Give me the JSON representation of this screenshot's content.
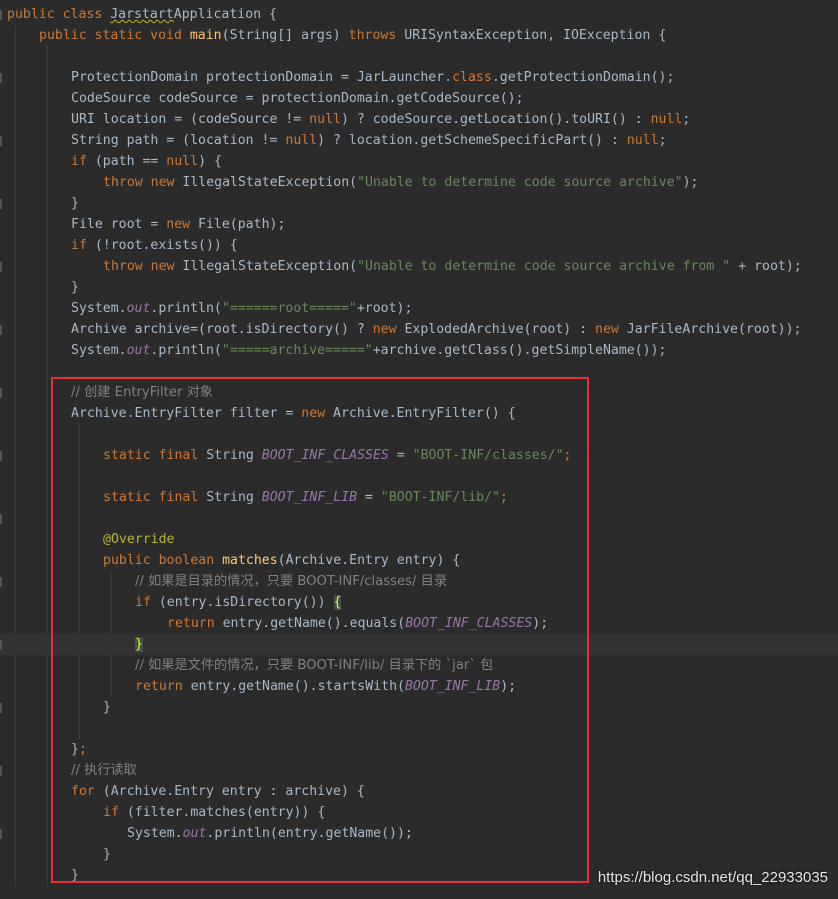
{
  "editor": {
    "lines": [
      {
        "indent": 0,
        "tokens": [
          {
            "t": "kw",
            "v": "public class "
          },
          {
            "t": "typo",
            "v": "Jarstart"
          },
          {
            "t": "plain",
            "v": "Application {"
          }
        ]
      },
      {
        "indent": 1,
        "tokens": [
          {
            "t": "kw",
            "v": "public static void "
          },
          {
            "t": "fn",
            "v": "main"
          },
          {
            "t": "plain",
            "v": "(String[] args) "
          },
          {
            "t": "kw",
            "v": "throws "
          },
          {
            "t": "plain",
            "v": "URISyntaxException, IOException {"
          }
        ]
      },
      {
        "indent": 0,
        "tokens": []
      },
      {
        "indent": 2,
        "tokens": [
          {
            "t": "plain",
            "v": "ProtectionDomain protectionDomain = JarLauncher."
          },
          {
            "t": "kw",
            "v": "class"
          },
          {
            "t": "plain",
            "v": ".getProtectionDomain();"
          }
        ]
      },
      {
        "indent": 2,
        "tokens": [
          {
            "t": "plain",
            "v": "CodeSource codeSource = protectionDomain.getCodeSource();"
          }
        ]
      },
      {
        "indent": 2,
        "tokens": [
          {
            "t": "plain",
            "v": "URI location = (codeSource != "
          },
          {
            "t": "kw",
            "v": "null"
          },
          {
            "t": "plain",
            "v": ") ? codeSource.getLocation().toURI() : "
          },
          {
            "t": "kw",
            "v": "null"
          },
          {
            "t": "plain",
            "v": ";"
          }
        ]
      },
      {
        "indent": 2,
        "tokens": [
          {
            "t": "plain",
            "v": "String path = (location != "
          },
          {
            "t": "kw",
            "v": "null"
          },
          {
            "t": "plain",
            "v": ") ? location.getSchemeSpecificPart() : "
          },
          {
            "t": "kw",
            "v": "null"
          },
          {
            "t": "plain",
            "v": ";"
          }
        ]
      },
      {
        "indent": 2,
        "tokens": [
          {
            "t": "kw",
            "v": "if "
          },
          {
            "t": "plain",
            "v": "(path == "
          },
          {
            "t": "kw",
            "v": "null"
          },
          {
            "t": "plain",
            "v": ") {"
          }
        ]
      },
      {
        "indent": 3,
        "tokens": [
          {
            "t": "kw",
            "v": "throw new "
          },
          {
            "t": "plain",
            "v": "IllegalStateException("
          },
          {
            "t": "str",
            "v": "\"Unable to determine code source archive\""
          },
          {
            "t": "plain",
            "v": ");"
          }
        ]
      },
      {
        "indent": 2,
        "tokens": [
          {
            "t": "plain",
            "v": "}"
          }
        ]
      },
      {
        "indent": 2,
        "tokens": [
          {
            "t": "plain",
            "v": "File root = "
          },
          {
            "t": "kw",
            "v": "new "
          },
          {
            "t": "plain",
            "v": "File(path);"
          }
        ]
      },
      {
        "indent": 2,
        "tokens": [
          {
            "t": "kw",
            "v": "if "
          },
          {
            "t": "plain",
            "v": "(!root.exists()) {"
          }
        ]
      },
      {
        "indent": 3,
        "tokens": [
          {
            "t": "kw",
            "v": "throw new "
          },
          {
            "t": "plain",
            "v": "IllegalStateException("
          },
          {
            "t": "str",
            "v": "\"Unable to determine code source archive from \""
          },
          {
            "t": "plain",
            "v": " + root);"
          }
        ]
      },
      {
        "indent": 2,
        "tokens": [
          {
            "t": "plain",
            "v": "}"
          }
        ]
      },
      {
        "indent": 2,
        "tokens": [
          {
            "t": "plain",
            "v": "System."
          },
          {
            "t": "field",
            "v": "out"
          },
          {
            "t": "plain",
            "v": ".println("
          },
          {
            "t": "str",
            "v": "\"======root=====\""
          },
          {
            "t": "plain",
            "v": "+root);"
          }
        ]
      },
      {
        "indent": 2,
        "tokens": [
          {
            "t": "plain",
            "v": "Archive archive=(root.isDirectory() ? "
          },
          {
            "t": "kw",
            "v": "new "
          },
          {
            "t": "plain",
            "v": "ExplodedArchive(root) : "
          },
          {
            "t": "kw",
            "v": "new "
          },
          {
            "t": "plain",
            "v": "JarFileArchive(root));"
          }
        ]
      },
      {
        "indent": 2,
        "tokens": [
          {
            "t": "plain",
            "v": "System."
          },
          {
            "t": "field",
            "v": "out"
          },
          {
            "t": "plain",
            "v": ".println("
          },
          {
            "t": "str",
            "v": "\"=====archive=====\""
          },
          {
            "t": "plain",
            "v": "+archive.getClass().getSimpleName());"
          }
        ]
      },
      {
        "indent": 0,
        "tokens": []
      },
      {
        "indent": 2,
        "tokens": [
          {
            "t": "com",
            "v": "// 创建 EntryFilter 对象"
          }
        ]
      },
      {
        "indent": 2,
        "tokens": [
          {
            "t": "plain",
            "v": "Archive.EntryFilter filter = "
          },
          {
            "t": "kw",
            "v": "new "
          },
          {
            "t": "plain",
            "v": "Archive.EntryFilter() {"
          }
        ]
      },
      {
        "indent": 0,
        "tokens": []
      },
      {
        "indent": 3,
        "tokens": [
          {
            "t": "kw",
            "v": "static final "
          },
          {
            "t": "plain",
            "v": "String "
          },
          {
            "t": "field",
            "v": "BOOT_INF_CLASSES"
          },
          {
            "t": "plain",
            "v": " = "
          },
          {
            "t": "str",
            "v": "\"BOOT-INF/classes/\""
          },
          {
            "t": "kw",
            "v": ";"
          }
        ]
      },
      {
        "indent": 0,
        "tokens": []
      },
      {
        "indent": 3,
        "tokens": [
          {
            "t": "kw",
            "v": "static final "
          },
          {
            "t": "plain",
            "v": "String "
          },
          {
            "t": "field",
            "v": "BOOT_INF_LIB"
          },
          {
            "t": "plain",
            "v": " = "
          },
          {
            "t": "str",
            "v": "\"BOOT-INF/lib/\""
          },
          {
            "t": "kw",
            "v": ";"
          }
        ]
      },
      {
        "indent": 0,
        "tokens": []
      },
      {
        "indent": 3,
        "tokens": [
          {
            "t": "ann",
            "v": "@Override"
          }
        ]
      },
      {
        "indent": 3,
        "tokens": [
          {
            "t": "kw",
            "v": "public boolean "
          },
          {
            "t": "fn",
            "v": "matches"
          },
          {
            "t": "plain",
            "v": "(Archive.Entry entry) {"
          }
        ]
      },
      {
        "indent": 4,
        "tokens": [
          {
            "t": "com",
            "v": "// 如果是目录的情况，只要 BOOT-INF/classes/ 目录"
          }
        ]
      },
      {
        "indent": 4,
        "tokens": [
          {
            "t": "kw",
            "v": "if "
          },
          {
            "t": "plain",
            "v": "(entry.isDirectory()) "
          },
          {
            "t": "brace",
            "v": "{"
          }
        ]
      },
      {
        "indent": 5,
        "tokens": [
          {
            "t": "kw",
            "v": "return "
          },
          {
            "t": "plain",
            "v": "entry.getName().equals("
          },
          {
            "t": "field",
            "v": "BOOT_INF_CLASSES"
          },
          {
            "t": "plain",
            "v": ");"
          }
        ]
      },
      {
        "indent": 4,
        "caret": true,
        "tokens": [
          {
            "t": "brace",
            "v": "}"
          }
        ]
      },
      {
        "indent": 4,
        "tokens": [
          {
            "t": "com",
            "v": "// 如果是文件的情况，只要 BOOT-INF/lib/ 目录下的 `jar` 包"
          }
        ]
      },
      {
        "indent": 4,
        "tokens": [
          {
            "t": "kw",
            "v": "return "
          },
          {
            "t": "plain",
            "v": "entry.getName().startsWith("
          },
          {
            "t": "field",
            "v": "BOOT_INF_LIB"
          },
          {
            "t": "plain",
            "v": ");"
          }
        ]
      },
      {
        "indent": 3,
        "tokens": [
          {
            "t": "plain",
            "v": "}"
          }
        ]
      },
      {
        "indent": 0,
        "tokens": []
      },
      {
        "indent": 2,
        "tokens": [
          {
            "t": "plain",
            "v": "}"
          },
          {
            "t": "kw",
            "v": ";"
          }
        ]
      },
      {
        "indent": 2,
        "tokens": [
          {
            "t": "com",
            "v": "// 执行读取"
          }
        ]
      },
      {
        "indent": 2,
        "tokens": [
          {
            "t": "kw",
            "v": "for "
          },
          {
            "t": "plain",
            "v": "(Archive.Entry entry : archive) {"
          }
        ]
      },
      {
        "indent": 3,
        "tokens": [
          {
            "t": "kw",
            "v": "if "
          },
          {
            "t": "plain",
            "v": "(filter.matches(entry)) {"
          }
        ]
      },
      {
        "indent": 3.75,
        "tokens": [
          {
            "t": "plain",
            "v": "System."
          },
          {
            "t": "field",
            "v": "out"
          },
          {
            "t": "plain",
            "v": ".println(entry.getName());"
          }
        ]
      },
      {
        "indent": 3,
        "tokens": [
          {
            "t": "plain",
            "v": "}"
          }
        ]
      },
      {
        "indent": 2,
        "tokens": [
          {
            "t": "plain",
            "v": "}"
          }
        ]
      }
    ]
  },
  "watermark": "https://blog.csdn.net/qq_22933035",
  "colors": {
    "background": "#2b2b2b",
    "keyword": "#cc7832",
    "string": "#6a8759",
    "field": "#9876aa",
    "function": "#ffc66d",
    "comment": "#808080",
    "annotation": "#bbb529",
    "highlight_box": "#e83030"
  }
}
